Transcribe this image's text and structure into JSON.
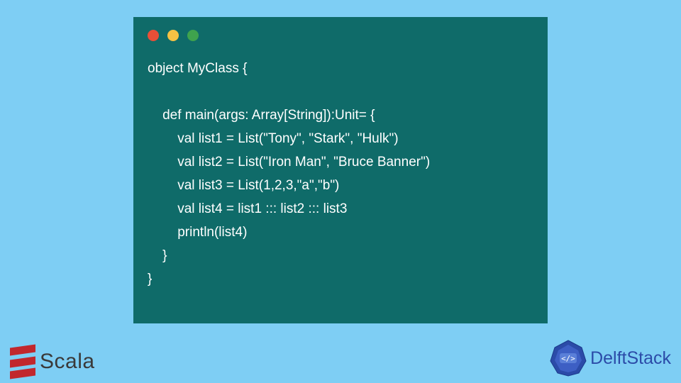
{
  "code": {
    "line1": "object MyClass {",
    "line2": "",
    "line3": "    def main(args: Array[String]):Unit= {",
    "line4": "        val list1 = List(\"Tony\", \"Stark\", \"Hulk\")",
    "line5": "        val list2 = List(\"Iron Man\", \"Bruce Banner\")",
    "line6": "        val list3 = List(1,2,3,\"a\",\"b\")",
    "line7": "        val list4 = list1 ::: list2 ::: list3",
    "line8": "        println(list4)",
    "line9": "    }",
    "line10": "}"
  },
  "scala_label": "Scala",
  "delft_label": "DelftStack",
  "colors": {
    "background": "#7ecef4",
    "code_bg": "#0f6b69",
    "code_text": "#ffffff",
    "scala_red": "#c1272d",
    "delft_blue": "#2b4ba8"
  }
}
